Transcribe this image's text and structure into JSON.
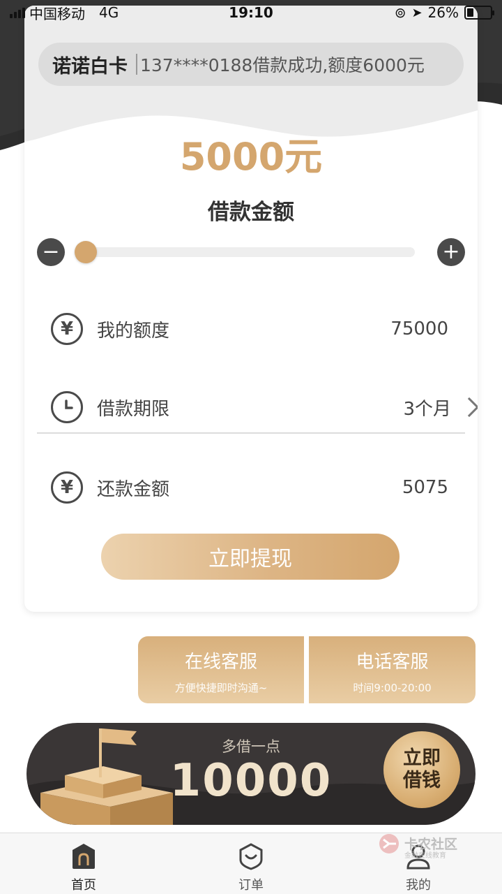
{
  "status_bar": {
    "carrier": "中国移动",
    "network": "4G",
    "time": "19:10",
    "battery": "26%"
  },
  "notice": {
    "brand": "诺诺白卡",
    "message": "137****0188借款成功,额度6000元"
  },
  "loan": {
    "amount": "5000元",
    "amount_label": "借款金额",
    "slider_fraction": 0.0
  },
  "info": {
    "quota_label": "我的额度",
    "quota_value": "75000",
    "term_label": "借款期限",
    "term_value": "3个月",
    "repay_label": "还款金额",
    "repay_value": "5075"
  },
  "withdraw_label": "立即提现",
  "service": {
    "online_title": "在线客服",
    "online_sub": "方便快捷即时沟通~",
    "phone_title": "电话客服",
    "phone_sub": "时间9:00-20:00"
  },
  "banner": {
    "sub": "多借一点",
    "number": "10000",
    "cta_line1": "立即",
    "cta_line2": "借钱"
  },
  "tabbar": {
    "home": "首页",
    "orders": "订单",
    "mine": "我的"
  },
  "watermark": {
    "title": "卡农社区",
    "sub": "金融在线教育"
  },
  "colors": {
    "accent": "#d4a66e",
    "dark": "#3a3636"
  }
}
